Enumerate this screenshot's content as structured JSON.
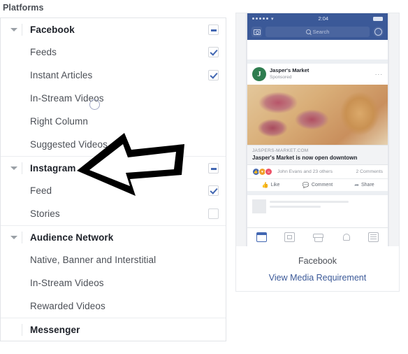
{
  "section": {
    "label": "Platforms"
  },
  "groups": [
    {
      "name": "facebook",
      "title": "Facebook",
      "caret": "caret-down-icon",
      "collapse_state": "indeterminate",
      "children": [
        {
          "label": "Feeds",
          "state": "checked"
        },
        {
          "label": "Instant Articles",
          "state": "checked"
        },
        {
          "label": "In-Stream Videos",
          "state": "none"
        },
        {
          "label": "Right Column",
          "state": "none"
        },
        {
          "label": "Suggested Videos",
          "state": "none"
        }
      ]
    },
    {
      "name": "instagram",
      "title": "Instagram",
      "caret": "caret-down-icon",
      "collapse_state": "indeterminate",
      "children": [
        {
          "label": "Feed",
          "state": "checked"
        },
        {
          "label": "Stories",
          "state": "unchecked"
        }
      ]
    },
    {
      "name": "audience-network",
      "title": "Audience Network",
      "caret": "caret-down-icon",
      "collapse_state": "none",
      "children": [
        {
          "label": "Native, Banner and Interstitial",
          "state": "none"
        },
        {
          "label": "In-Stream Videos",
          "state": "none"
        },
        {
          "label": "Rewarded Videos",
          "state": "none"
        }
      ]
    },
    {
      "name": "messenger",
      "title": "Messenger",
      "caret": "none",
      "collapse_state": "none",
      "children": []
    }
  ],
  "annotation": {
    "shape": "hand-drawn-left-arrow",
    "color": "#000000",
    "points_at": "Instagram"
  },
  "cursor": {
    "shape": "circle-ring",
    "color": "#9fa6c4"
  },
  "preview": {
    "caption": "Facebook",
    "media_link": "View Media Requirement",
    "phone": {
      "status": {
        "time": "2:04",
        "signal_dots": 5,
        "wifi": "wifi-icon",
        "battery": "battery-icon"
      },
      "navbar": {
        "camera": "camera-icon",
        "search_placeholder": "Search",
        "search_icon": "search-icon",
        "messenger": "messenger-icon"
      },
      "post": {
        "brand": "Jasper's Market",
        "brand_initial": "J",
        "sponsored": "Sponsored",
        "globe": "globe-icon",
        "more": "···",
        "image_alt": "food-photo",
        "link_domain": "JASPERS-MARKET.COM",
        "link_title": "Jasper's Market is now open downtown",
        "reactions_text": "John Evans and 23 others",
        "comments_text": "2 Comments",
        "actions": [
          {
            "label": "Like",
            "icon": "thumbs-up-icon",
            "glyph": "ὄD"
          },
          {
            "label": "Comment",
            "icon": "comment-icon",
            "glyph": "○"
          },
          {
            "label": "Share",
            "icon": "share-icon",
            "glyph": "↱"
          }
        ]
      },
      "tabs": [
        {
          "name": "news-feed",
          "icon": "news-feed-icon",
          "active": true
        },
        {
          "name": "watch",
          "icon": "video-icon",
          "active": false
        },
        {
          "name": "marketplace",
          "icon": "marketplace-icon",
          "active": false
        },
        {
          "name": "notifications",
          "icon": "bell-icon",
          "active": false
        },
        {
          "name": "menu",
          "icon": "menu-icon",
          "active": false
        }
      ]
    }
  },
  "colors": {
    "fb_blue": "#3b5998",
    "accent_blue": "#4267b2",
    "link_blue": "#3b5998",
    "text": "#1d2129",
    "muted": "#4b4f56",
    "border": "#e2e4e8"
  }
}
